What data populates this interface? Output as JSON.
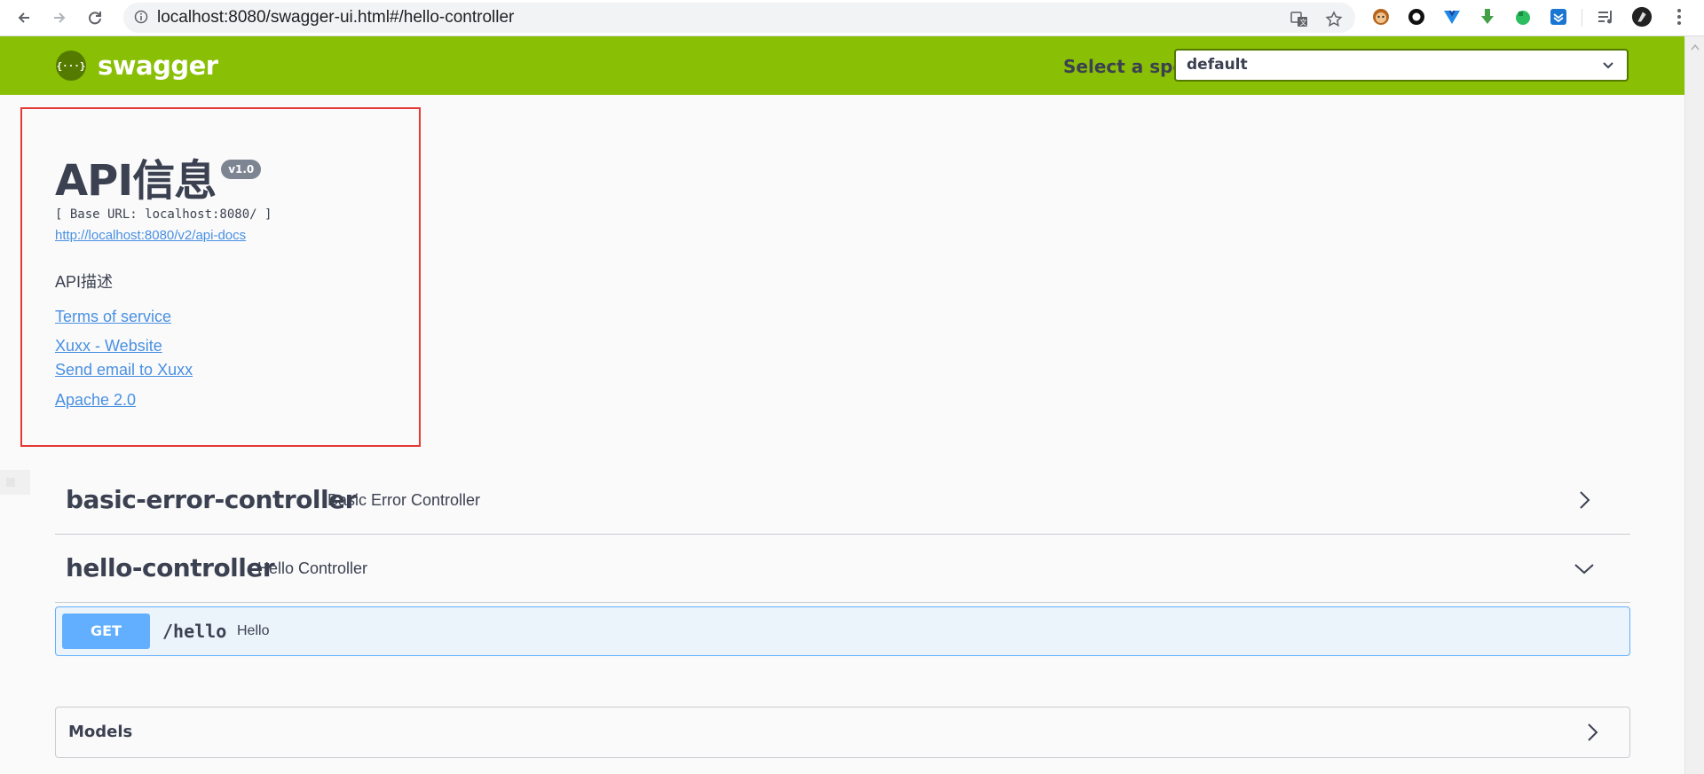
{
  "browser": {
    "url": "localhost:8080/swagger-ui.html#/hello-controller",
    "icons": [
      "back-icon",
      "forward-icon",
      "reload-icon",
      "info-icon",
      "translate-icon",
      "star-icon"
    ],
    "extensions": [
      "monkey-extension-icon",
      "circle-extension-icon",
      "vue-extension-icon",
      "download-extension-icon",
      "evernote-extension-icon",
      "save-extension-icon",
      "media-icon",
      "profile-avatar",
      "menu-icon"
    ]
  },
  "topbar": {
    "logo_symbol": "{···}",
    "brand": "swagger",
    "spec_label": "Select a spec",
    "spec_value": "default"
  },
  "info": {
    "title": "API信息",
    "version": "v1.0",
    "base_url": "[ Base URL: localhost:8080/ ]",
    "api_docs_link": "http://localhost:8080/v2/api-docs",
    "description": "API描述",
    "terms": "Terms of service",
    "website": "Xuxx - Website",
    "email": "Send email to Xuxx",
    "license": "Apache 2.0"
  },
  "tags": [
    {
      "name": "basic-error-controller",
      "description": "Basic Error Controller",
      "state": "collapsed"
    },
    {
      "name": "hello-controller",
      "description": "Hello Controller",
      "state": "expanded"
    }
  ],
  "operation": {
    "method": "GET",
    "path": "/hello",
    "summary": "Hello"
  },
  "models": {
    "label": "Models"
  },
  "colors": {
    "topbar": "#89bf04",
    "get": "#61affe",
    "link": "#4990e2",
    "highlight_box": "#e53935"
  }
}
